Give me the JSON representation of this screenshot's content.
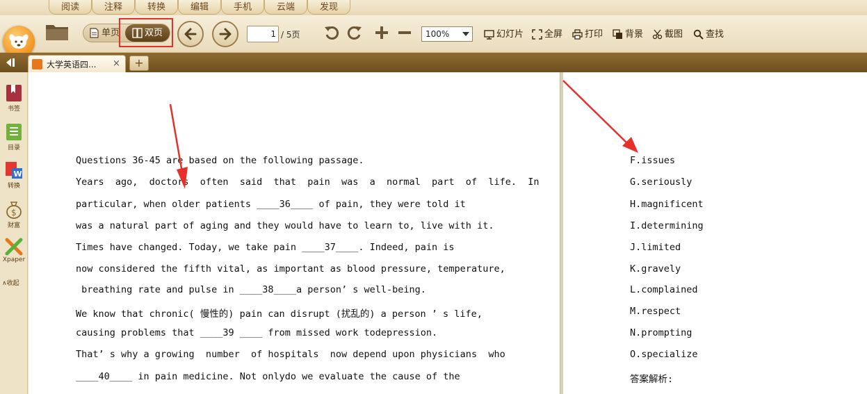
{
  "menu": {
    "tabs": [
      {
        "label": "阅读"
      },
      {
        "label": "注释"
      },
      {
        "label": "转换"
      },
      {
        "label": "编辑"
      },
      {
        "label": "手机"
      },
      {
        "label": "云端"
      },
      {
        "label": "发现"
      }
    ]
  },
  "toolbar": {
    "single_page": "单页",
    "double_page": "双页",
    "page_current": "1",
    "page_total": "/ 5页",
    "zoom": "100%",
    "slideshow": "幻灯片",
    "fullscreen": "全屏",
    "print": "打印",
    "background": "背景",
    "screenshot": "截图",
    "search": "查找"
  },
  "tabbar": {
    "doc_title": "大学英语四...",
    "close": "×",
    "new_tab": "+"
  },
  "sidebar": {
    "bookmark": "书签",
    "toc": "目录",
    "convert": "转换",
    "wealth": "财富",
    "xpaper": "Xpaper",
    "collapse": "∧收起"
  },
  "left_page": {
    "lines": [
      "Questions 36-45 are based on the following passage.",
      "Years  ago,  doctors  often  said  that  pain  was  a  normal  part  of  life.  In",
      "particular, when older patients ____36____ of pain, they were told it",
      "was a natural part of aging and they would have to learn to, live with it.",
      "Times have changed. Today, we take pain ____37____. Indeed, pain is",
      "now considered the fifth vital, as important as blood pressure, temperature,",
      " breathing rate and pulse in ____38____a person’ s well-being.",
      "We know that chronic( 慢性的) pain can disrupt (扰乱的) a person ’ s life,",
      "causing problems that ____39 ____ from missed work todepression.",
      "That’ s why a growing  number  of hospitals  now depend upon physicians  who",
      "____40____ in pain medicine. Not onlydo we evaluate the cause of the"
    ]
  },
  "right_page": {
    "lines": [
      "F.issues",
      "G.seriously",
      "H.magnificent",
      "I.determining",
      "J.limited",
      "K.gravely",
      "L.complained",
      "M.respect",
      "N.prompting",
      "O.specialize",
      "答案解析:"
    ]
  },
  "colors": {
    "annotation_red": "#e8302a",
    "toolbar_bg": "#f6eedb",
    "tabbar_bg": "#7d5c27"
  }
}
